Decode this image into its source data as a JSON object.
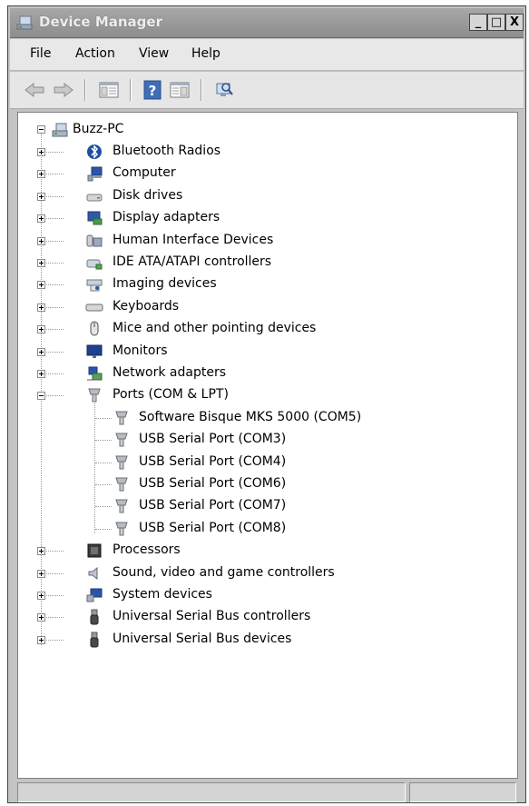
{
  "window": {
    "title": "Device Manager",
    "minimize": "_",
    "maximize": "□",
    "close": "X"
  },
  "menu": [
    "File",
    "Action",
    "View",
    "Help"
  ],
  "toolbar": {
    "icons": [
      "back-arrow-icon",
      "forward-arrow-icon",
      "show-hide-console-tree-icon",
      "help-icon",
      "properties-icon",
      "scan-hardware-icon"
    ]
  },
  "tree": {
    "root": "Buzz-PC",
    "categories": [
      {
        "label": "Bluetooth Radios",
        "icon": "bluetooth-icon"
      },
      {
        "label": "Computer",
        "icon": "computer-icon"
      },
      {
        "label": "Disk drives",
        "icon": "disk-drive-icon"
      },
      {
        "label": "Display adapters",
        "icon": "display-adapter-icon"
      },
      {
        "label": "Human Interface Devices",
        "icon": "hid-icon"
      },
      {
        "label": "IDE ATA/ATAPI controllers",
        "icon": "ide-controller-icon"
      },
      {
        "label": "Imaging devices",
        "icon": "imaging-device-icon"
      },
      {
        "label": "Keyboards",
        "icon": "keyboard-icon"
      },
      {
        "label": "Mice and other pointing devices",
        "icon": "mouse-icon"
      },
      {
        "label": "Monitors",
        "icon": "monitor-icon"
      },
      {
        "label": "Network adapters",
        "icon": "network-adapter-icon"
      },
      {
        "label": "Ports (COM & LPT)",
        "icon": "port-icon"
      },
      {
        "label": "Processors",
        "icon": "processor-icon"
      },
      {
        "label": "Sound, video and game controllers",
        "icon": "speaker-icon"
      },
      {
        "label": "System devices",
        "icon": "system-device-icon"
      },
      {
        "label": "Universal Serial Bus controllers",
        "icon": "usb-icon"
      },
      {
        "label": "Universal Serial Bus devices",
        "icon": "usb-icon"
      }
    ],
    "ports": [
      "Software Bisque MKS 5000 (COM5)",
      "USB Serial Port (COM3)",
      "USB Serial Port (COM4)",
      "USB Serial Port (COM6)",
      "USB Serial Port (COM7)",
      "USB Serial Port (COM8)"
    ]
  }
}
